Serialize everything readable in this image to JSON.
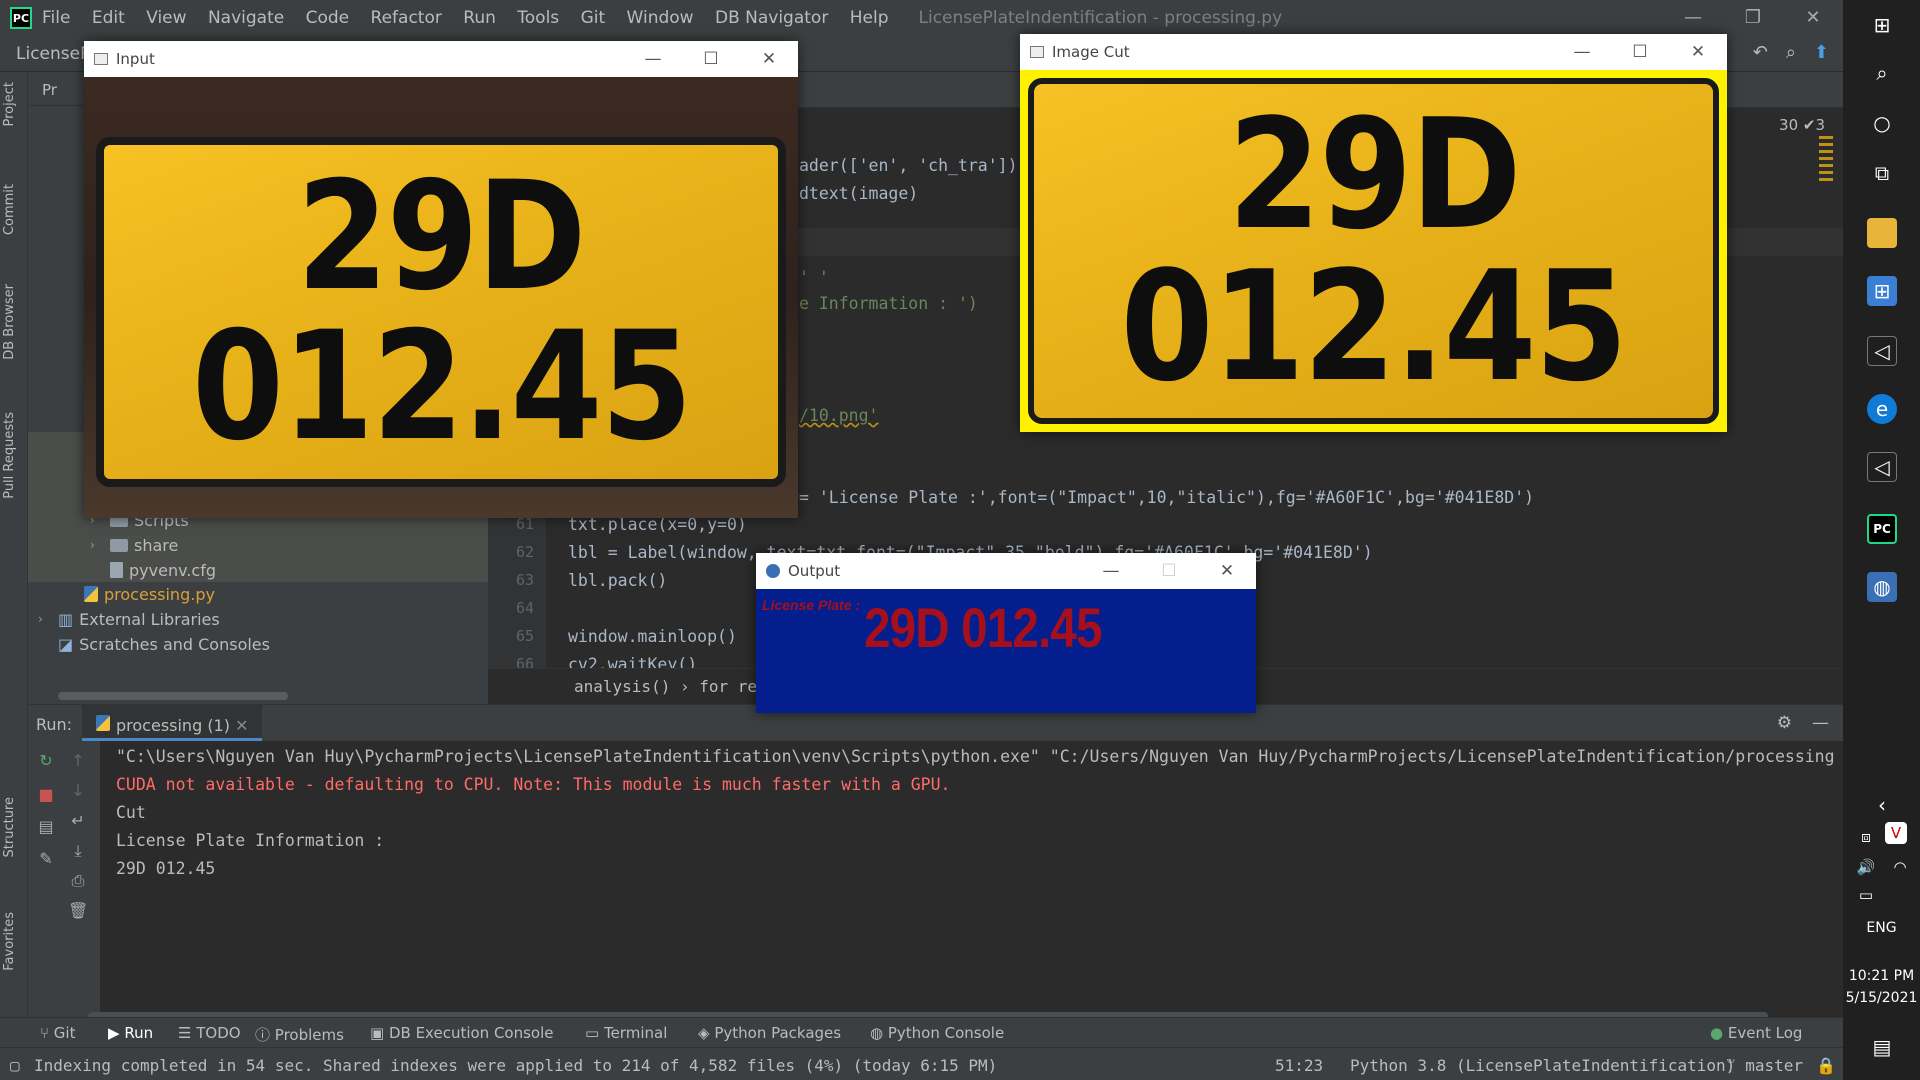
{
  "ide": {
    "title": "LicensePlateIndentification - processing.py",
    "menu": [
      "File",
      "Edit",
      "View",
      "Navigate",
      "Code",
      "Refactor",
      "Run",
      "Tools",
      "Git",
      "Window",
      "DB Navigator",
      "Help"
    ],
    "nav_project": "LicenseP",
    "editor_status": "30 ✔3"
  },
  "left_tabs": [
    "Project",
    "Commit",
    "DB Browser",
    "Pull Requests",
    "Structure",
    "Favorites"
  ],
  "project_panel": {
    "header": "Pr",
    "tree": [
      {
        "label": "Scripts",
        "type": "folder"
      },
      {
        "label": "share",
        "type": "folder"
      },
      {
        "label": "pyvenv.cfg",
        "type": "cfg"
      },
      {
        "label": "processing.py",
        "type": "py"
      },
      {
        "label": "External Libraries",
        "type": "lib"
      },
      {
        "label": "Scratches and Consoles",
        "type": "scratch"
      }
    ]
  },
  "code": {
    "frag1": "ader(['en', 'ch_tra'])",
    "frag2": "dtext(image)",
    "frag3": "' '",
    "frag4": "e Information : ')",
    "frag5": "/10.png'",
    "frag6": "= 'License Plate :',font=(\"Impact\",10,\"italic\"),fg='#A60F1C',bg='#041E8D')",
    "lines": [
      {
        "n": "61",
        "text": "txt.place(x=0,y=0)"
      },
      {
        "n": "62",
        "text": "lbl = Label(window, text=txt,font=(\"Impact\",35,\"bold\"),fg='#A60F1C',bg='#041E8D')"
      },
      {
        "n": "63",
        "text": "lbl.pack()"
      },
      {
        "n": "64",
        "text": ""
      },
      {
        "n": "65",
        "text": "window.mainloop()"
      },
      {
        "n": "66",
        "text": "cv2.waitKey()"
      }
    ],
    "breadcrumb": "analysis()  ›  for res"
  },
  "run": {
    "label": "Run:",
    "tab": "processing (1)",
    "console": [
      {
        "text": "\"C:\\Users\\Nguyen Van Huy\\PycharmProjects\\LicensePlateIndentification\\venv\\Scripts\\python.exe\" \"C:/Users/Nguyen Van Huy/PycharmProjects/LicensePlateIndentification/processing",
        "err": false
      },
      {
        "text": "CUDA not available - defaulting to CPU. Note: This module is much faster with a GPU.",
        "err": true
      },
      {
        "text": "Cut",
        "err": false
      },
      {
        "text": "License Plate Information :",
        "err": false
      },
      {
        "text": "29D 012.45",
        "err": false
      }
    ]
  },
  "bottom_tabs": [
    "Git",
    "Run",
    "TODO",
    "Problems",
    "DB Execution Console",
    "Terminal",
    "Python Packages",
    "Python Console",
    "Event Log"
  ],
  "status": {
    "message": "Indexing completed in 54 sec. Shared indexes were applied to 214 of 4,582 files (4%) (today 6:15 PM)",
    "position": "51:23",
    "interpreter": "Python 3.8 (LicensePlateIndentification)",
    "branch": "master"
  },
  "windows": {
    "input": {
      "title": "Input",
      "line1": "29D",
      "line2": "012.45"
    },
    "image_cut": {
      "title": "Image Cut",
      "line1": "29D",
      "line2": "012.45"
    },
    "output": {
      "title": "Output",
      "label": "License Plate :",
      "plate": "29D 012.45"
    }
  },
  "taskbar": {
    "lang": "ENG",
    "time": "10:21 PM",
    "date": "5/15/2021"
  },
  "colors": {
    "label_fg": "#A60F1C",
    "label_bg": "#041E8D",
    "plate_yellow": "#F2BE22",
    "cut_border": "#FFF200"
  }
}
